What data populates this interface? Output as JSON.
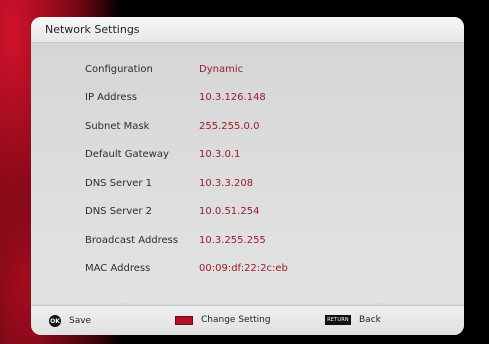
{
  "window": {
    "title": "Network Settings"
  },
  "settings": [
    {
      "label": "Configuration",
      "value": "Dynamic"
    },
    {
      "label": "IP Address",
      "value": "10.3.126.148"
    },
    {
      "label": "Subnet Mask",
      "value": "255.255.0.0"
    },
    {
      "label": "Default Gateway",
      "value": "10.3.0.1"
    },
    {
      "label": "DNS Server 1",
      "value": "10.3.3.208"
    },
    {
      "label": "DNS Server 2",
      "value": "10.0.51.254"
    },
    {
      "label": "Broadcast Address",
      "value": "10.3.255.255"
    },
    {
      "label": "MAC Address",
      "value": "00:09:df:22:2c:eb"
    }
  ],
  "footer": {
    "save_icon_text": "OK",
    "save_label": "Save",
    "change_label": "Change Setting",
    "back_icon_text": "RETURN",
    "back_label": "Back"
  },
  "colors": {
    "accent_red": "#b11225",
    "value_text": "#9b1c2b",
    "panel_bg": "#e4e4e4"
  },
  "icons": {
    "save": "ok-button-icon",
    "change": "red-key-icon",
    "back": "return-button-icon"
  }
}
